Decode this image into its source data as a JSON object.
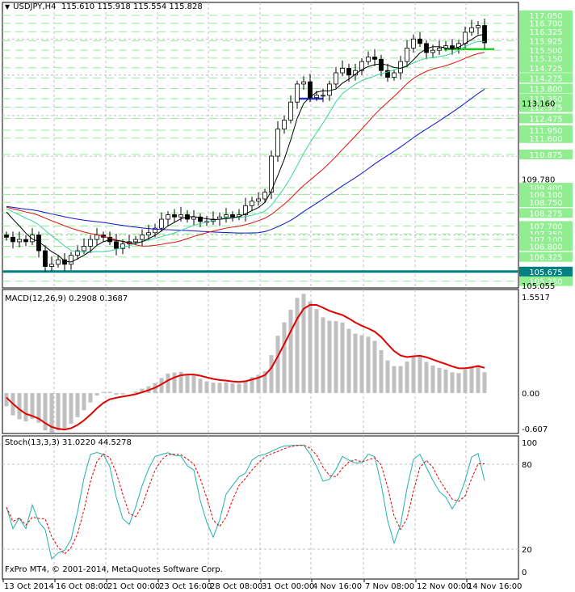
{
  "header": {
    "symbol": "USDJPY,H4",
    "ohlc": "115.610 115.918 115.554 115.828",
    "menu_icon": "triangle-down-icon"
  },
  "macd": {
    "label": "MACD(12,26,9) 0.2908 0.3687",
    "axis": [
      "1.5517",
      "0.00",
      "-0.607"
    ]
  },
  "stoch": {
    "label": "Stoch(13,3,3) 31.0220 44.5278",
    "axis": [
      "100",
      "80",
      "20",
      "0"
    ]
  },
  "copyright": "FxPro MT4, © 2001-2014, MetaQuotes Software Corp.",
  "time_axis": [
    "13 Oct 2014",
    "16 Oct 08:00",
    "21 Oct 00:00",
    "23 Oct 16:00",
    "28 Oct 08:00",
    "31 Oct 00:00",
    "4 Nov 16:00",
    "7 Nov 08:00",
    "12 Nov 00:00",
    "14 Nov 16:00"
  ],
  "price_axis": {
    "levels": [
      "117.050",
      "116.700",
      "116.325",
      "115.925",
      "115.500",
      "115.150",
      "114.725",
      "114.275",
      "113.800",
      "113.350",
      "112.975",
      "112.475",
      "111.950",
      "111.600",
      "110.875",
      "109.400",
      "109.100",
      "108.750",
      "108.275",
      "107.700",
      "107.350",
      "107.100",
      "106.800",
      "106.325",
      "105.250"
    ],
    "key_level": "105.675",
    "ticks": [
      "109.780",
      "113.160",
      "105.055"
    ]
  },
  "colors": {
    "level": "#90ee90",
    "key_level": "#008080",
    "ma_fast": "#000000",
    "ma_mid": "#3cd3a0",
    "ma_slow": "#e01010",
    "ma_long": "#1010d0",
    "macd_hist": "#c0c0c0",
    "macd_signal": "#e00000",
    "stoch_main": "#20b2aa",
    "stoch_signal": "#e00000"
  },
  "chart_data": {
    "type": "candlestick",
    "symbol": "USDJPY",
    "timeframe": "H4",
    "ylim": [
      105.055,
      117.3
    ],
    "closes": [
      107.2,
      107.0,
      107.1,
      107.0,
      107.3,
      106.6,
      105.9,
      106.0,
      106.2,
      106.0,
      106.4,
      106.6,
      106.8,
      107.1,
      107.3,
      107.2,
      107.0,
      106.7,
      106.9,
      107.0,
      107.1,
      107.3,
      107.4,
      107.6,
      108.0,
      108.2,
      108.1,
      108.2,
      108.0,
      108.1,
      107.9,
      107.9,
      108.0,
      108.1,
      108.2,
      108.1,
      108.2,
      108.6,
      108.8,
      108.9,
      109.2,
      110.8,
      112.0,
      112.4,
      113.2,
      114.0,
      114.1,
      113.4,
      113.5,
      113.5,
      114.0,
      114.5,
      114.7,
      114.4,
      114.6,
      115.0,
      115.2,
      115.1,
      114.6,
      114.3,
      114.5,
      115.0,
      115.6,
      116.0,
      115.8,
      115.4,
      115.5,
      115.6,
      115.7,
      115.6,
      115.8,
      116.3,
      116.5,
      116.6,
      115.83
    ]
  }
}
